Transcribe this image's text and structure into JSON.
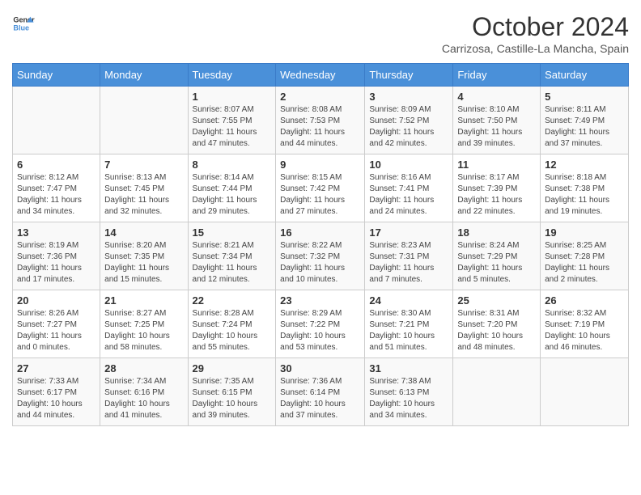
{
  "header": {
    "logo_line1": "General",
    "logo_line2": "Blue",
    "month": "October 2024",
    "location": "Carrizosa, Castille-La Mancha, Spain"
  },
  "days_of_week": [
    "Sunday",
    "Monday",
    "Tuesday",
    "Wednesday",
    "Thursday",
    "Friday",
    "Saturday"
  ],
  "weeks": [
    [
      {
        "day": "",
        "info": ""
      },
      {
        "day": "",
        "info": ""
      },
      {
        "day": "1",
        "info": "Sunrise: 8:07 AM\nSunset: 7:55 PM\nDaylight: 11 hours and 47 minutes."
      },
      {
        "day": "2",
        "info": "Sunrise: 8:08 AM\nSunset: 7:53 PM\nDaylight: 11 hours and 44 minutes."
      },
      {
        "day": "3",
        "info": "Sunrise: 8:09 AM\nSunset: 7:52 PM\nDaylight: 11 hours and 42 minutes."
      },
      {
        "day": "4",
        "info": "Sunrise: 8:10 AM\nSunset: 7:50 PM\nDaylight: 11 hours and 39 minutes."
      },
      {
        "day": "5",
        "info": "Sunrise: 8:11 AM\nSunset: 7:49 PM\nDaylight: 11 hours and 37 minutes."
      }
    ],
    [
      {
        "day": "6",
        "info": "Sunrise: 8:12 AM\nSunset: 7:47 PM\nDaylight: 11 hours and 34 minutes."
      },
      {
        "day": "7",
        "info": "Sunrise: 8:13 AM\nSunset: 7:45 PM\nDaylight: 11 hours and 32 minutes."
      },
      {
        "day": "8",
        "info": "Sunrise: 8:14 AM\nSunset: 7:44 PM\nDaylight: 11 hours and 29 minutes."
      },
      {
        "day": "9",
        "info": "Sunrise: 8:15 AM\nSunset: 7:42 PM\nDaylight: 11 hours and 27 minutes."
      },
      {
        "day": "10",
        "info": "Sunrise: 8:16 AM\nSunset: 7:41 PM\nDaylight: 11 hours and 24 minutes."
      },
      {
        "day": "11",
        "info": "Sunrise: 8:17 AM\nSunset: 7:39 PM\nDaylight: 11 hours and 22 minutes."
      },
      {
        "day": "12",
        "info": "Sunrise: 8:18 AM\nSunset: 7:38 PM\nDaylight: 11 hours and 19 minutes."
      }
    ],
    [
      {
        "day": "13",
        "info": "Sunrise: 8:19 AM\nSunset: 7:36 PM\nDaylight: 11 hours and 17 minutes."
      },
      {
        "day": "14",
        "info": "Sunrise: 8:20 AM\nSunset: 7:35 PM\nDaylight: 11 hours and 15 minutes."
      },
      {
        "day": "15",
        "info": "Sunrise: 8:21 AM\nSunset: 7:34 PM\nDaylight: 11 hours and 12 minutes."
      },
      {
        "day": "16",
        "info": "Sunrise: 8:22 AM\nSunset: 7:32 PM\nDaylight: 11 hours and 10 minutes."
      },
      {
        "day": "17",
        "info": "Sunrise: 8:23 AM\nSunset: 7:31 PM\nDaylight: 11 hours and 7 minutes."
      },
      {
        "day": "18",
        "info": "Sunrise: 8:24 AM\nSunset: 7:29 PM\nDaylight: 11 hours and 5 minutes."
      },
      {
        "day": "19",
        "info": "Sunrise: 8:25 AM\nSunset: 7:28 PM\nDaylight: 11 hours and 2 minutes."
      }
    ],
    [
      {
        "day": "20",
        "info": "Sunrise: 8:26 AM\nSunset: 7:27 PM\nDaylight: 11 hours and 0 minutes."
      },
      {
        "day": "21",
        "info": "Sunrise: 8:27 AM\nSunset: 7:25 PM\nDaylight: 10 hours and 58 minutes."
      },
      {
        "day": "22",
        "info": "Sunrise: 8:28 AM\nSunset: 7:24 PM\nDaylight: 10 hours and 55 minutes."
      },
      {
        "day": "23",
        "info": "Sunrise: 8:29 AM\nSunset: 7:22 PM\nDaylight: 10 hours and 53 minutes."
      },
      {
        "day": "24",
        "info": "Sunrise: 8:30 AM\nSunset: 7:21 PM\nDaylight: 10 hours and 51 minutes."
      },
      {
        "day": "25",
        "info": "Sunrise: 8:31 AM\nSunset: 7:20 PM\nDaylight: 10 hours and 48 minutes."
      },
      {
        "day": "26",
        "info": "Sunrise: 8:32 AM\nSunset: 7:19 PM\nDaylight: 10 hours and 46 minutes."
      }
    ],
    [
      {
        "day": "27",
        "info": "Sunrise: 7:33 AM\nSunset: 6:17 PM\nDaylight: 10 hours and 44 minutes."
      },
      {
        "day": "28",
        "info": "Sunrise: 7:34 AM\nSunset: 6:16 PM\nDaylight: 10 hours and 41 minutes."
      },
      {
        "day": "29",
        "info": "Sunrise: 7:35 AM\nSunset: 6:15 PM\nDaylight: 10 hours and 39 minutes."
      },
      {
        "day": "30",
        "info": "Sunrise: 7:36 AM\nSunset: 6:14 PM\nDaylight: 10 hours and 37 minutes."
      },
      {
        "day": "31",
        "info": "Sunrise: 7:38 AM\nSunset: 6:13 PM\nDaylight: 10 hours and 34 minutes."
      },
      {
        "day": "",
        "info": ""
      },
      {
        "day": "",
        "info": ""
      }
    ]
  ]
}
